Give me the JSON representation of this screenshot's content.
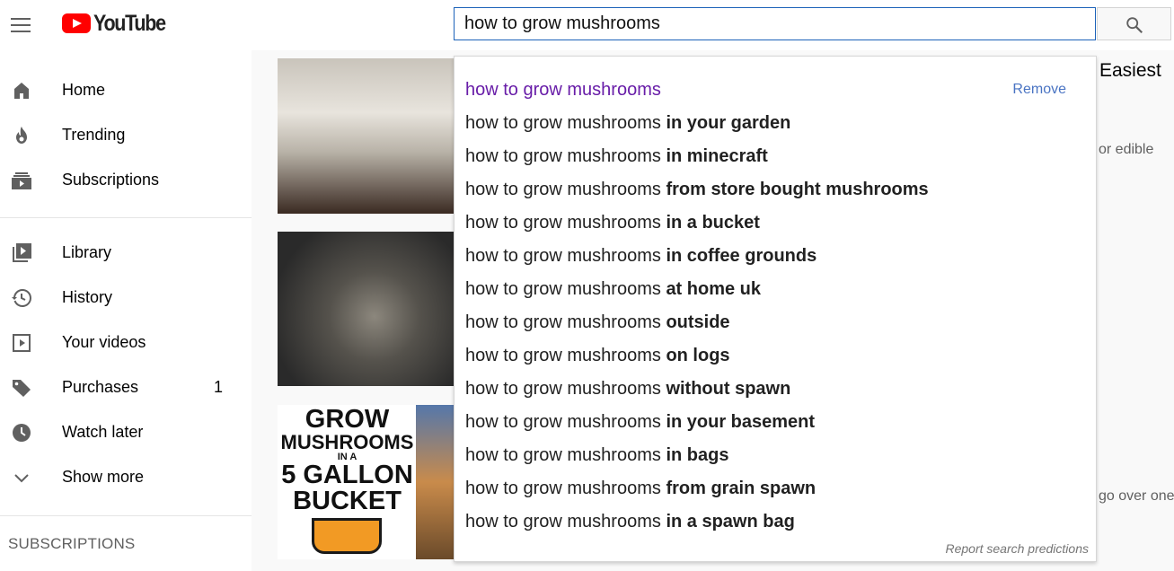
{
  "masthead": {
    "logo_text": "YouTube",
    "search_value": "how to grow mushrooms"
  },
  "sidebar": {
    "primary": [
      {
        "label": "Home",
        "icon": "home-icon"
      },
      {
        "label": "Trending",
        "icon": "flame-icon"
      },
      {
        "label": "Subscriptions",
        "icon": "subscriptions-icon"
      }
    ],
    "secondary": [
      {
        "label": "Library",
        "icon": "library-icon"
      },
      {
        "label": "History",
        "icon": "history-icon"
      },
      {
        "label": "Your videos",
        "icon": "play-square-icon"
      },
      {
        "label": "Purchases",
        "icon": "tag-icon",
        "count": "1"
      },
      {
        "label": "Watch later",
        "icon": "clock-icon"
      },
      {
        "label": "Show more",
        "icon": "chevron-down-icon"
      }
    ],
    "section_header": "SUBSCRIPTIONS"
  },
  "content": {
    "partial_title": "Easiest",
    "partial_meta_1": "or edible",
    "partial_meta_2": "go over one",
    "thumb3_lines": [
      "GROW",
      "MUSHROOMS",
      "IN A",
      "5 GALLON",
      "BUCKET"
    ]
  },
  "dropdown": {
    "query": "how to grow mushrooms",
    "remove_label": "Remove",
    "suggestions": [
      "",
      "in your garden",
      "in minecraft",
      "from store bought mushrooms",
      "in a bucket",
      "in coffee grounds",
      "at home uk",
      "outside",
      "on logs",
      "without spawn",
      "in your basement",
      "in bags",
      "from grain spawn",
      "in a spawn bag"
    ],
    "report_label": "Report search predictions"
  },
  "colors": {
    "history_suggestion": "#681da8",
    "link": "#4a74c3",
    "search_border": "#1c62b9",
    "logo_red": "#ff0000"
  }
}
